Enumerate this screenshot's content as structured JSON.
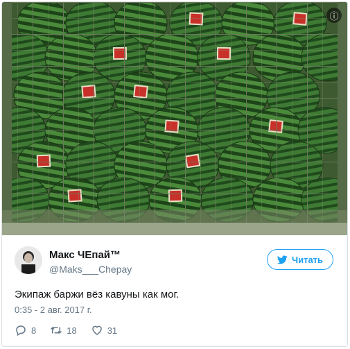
{
  "tweet": {
    "author_name": "Макс ЧЕпай™",
    "author_handle": "@Maks___Chepay",
    "follow_label": "Читать",
    "text": "Экипаж баржи вёз кавуны как мог.",
    "timestamp": "0:35 - 2 авг. 2017 г.",
    "replies": "8",
    "retweets": "18",
    "likes": "31",
    "info_icon": "ⓘ"
  },
  "icons": {
    "info": "info-icon",
    "bird": "twitter-bird-icon",
    "reply": "reply-icon",
    "retweet": "retweet-icon",
    "like": "heart-icon"
  },
  "colors": {
    "accent": "#1da1f2",
    "muted": "#657786",
    "text": "#14171a",
    "border": "#d9dee3"
  }
}
